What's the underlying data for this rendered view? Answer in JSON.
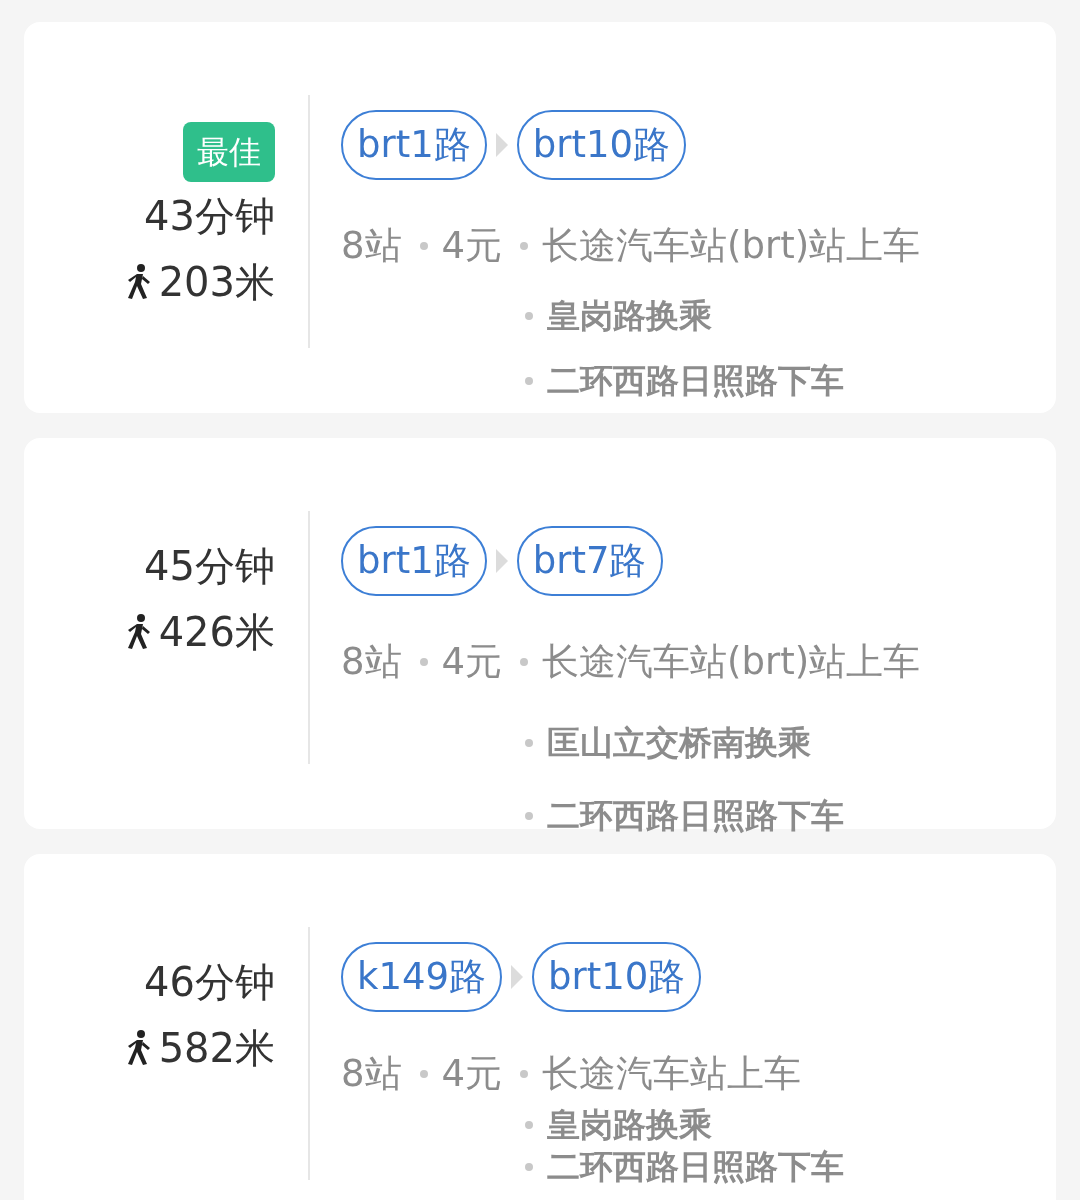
{
  "routes": [
    {
      "badge": "最佳",
      "duration": "43分钟",
      "walk": "203米",
      "lines": [
        "brt1路",
        "brt10路"
      ],
      "stops": "8站",
      "fare": "4元",
      "board": "长途汽车站(brt)站上车",
      "steps": [
        "皇岗路换乘",
        "二环西路日照路下车"
      ]
    },
    {
      "duration": "45分钟",
      "walk": "426米",
      "lines": [
        "brt1路",
        "brt7路"
      ],
      "stops": "8站",
      "fare": "4元",
      "board": "长途汽车站(brt)站上车",
      "steps": [
        "匡山立交桥南换乘",
        "二环西路日照路下车"
      ]
    },
    {
      "duration": "46分钟",
      "walk": "582米",
      "lines": [
        "k149路",
        "brt10路"
      ],
      "stops": "8站",
      "fare": "4元",
      "board": "长途汽车站上车",
      "steps": [
        "皇岗路换乘",
        "二环西路日照路下车"
      ]
    }
  ]
}
